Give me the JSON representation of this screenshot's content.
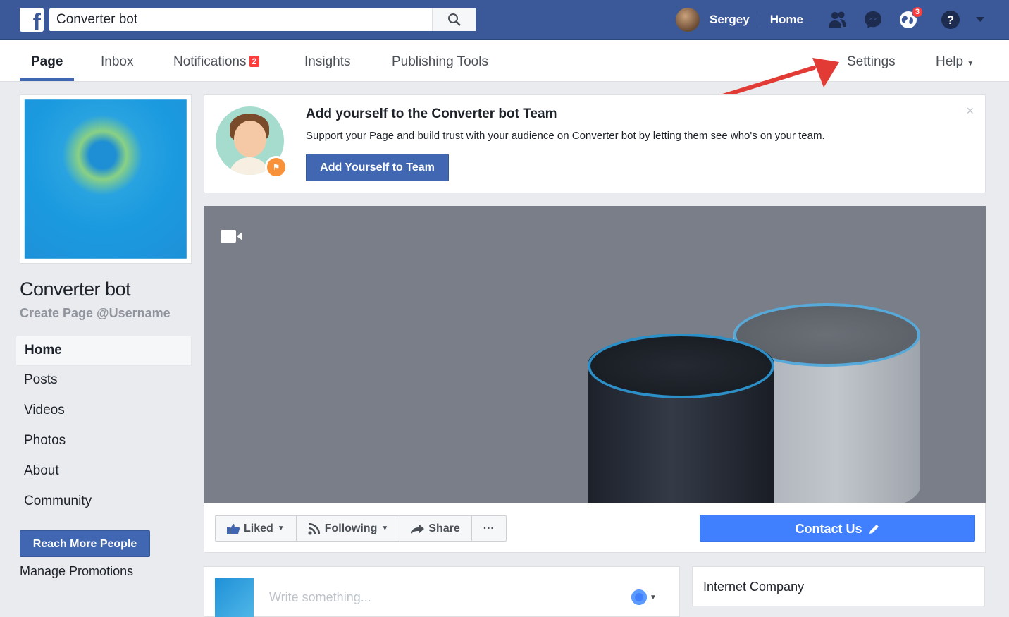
{
  "topbar": {
    "logo": "f",
    "search_value": "Converter bot",
    "user_name": "Sergey",
    "home_label": "Home",
    "notif_count": "3",
    "icons": [
      "friends-icon",
      "messenger-icon",
      "globe-icon",
      "help-icon",
      "caret-down-icon"
    ]
  },
  "page_nav": {
    "page": "Page",
    "inbox": "Inbox",
    "notifications": "Notifications",
    "notifications_count": "2",
    "insights": "Insights",
    "publishing_tools": "Publishing Tools",
    "settings": "Settings",
    "help": "Help"
  },
  "left": {
    "page_name": "Converter bot",
    "username_link": "Create Page @Username",
    "nav": [
      "Home",
      "Posts",
      "Videos",
      "Photos",
      "About",
      "Community"
    ],
    "reach_button": "Reach More People",
    "manage_promotions": "Manage Promotions"
  },
  "team_card": {
    "title": "Add yourself to the Converter bot Team",
    "description": "Support your Page and build trust with your audience on Converter bot by letting them see who's on your team.",
    "button": "Add Yourself to Team",
    "close": "×"
  },
  "actions": {
    "liked": "Liked",
    "following": "Following",
    "share": "Share",
    "more": "···",
    "contact": "Contact Us"
  },
  "composer": {
    "placeholder": "Write something..."
  },
  "about": {
    "category": "Internet Company"
  },
  "colors": {
    "brand_blue": "#3b5998",
    "button_blue": "#4267b2",
    "contact_blue": "#4080ff",
    "annotation_red": "#e23b36"
  }
}
